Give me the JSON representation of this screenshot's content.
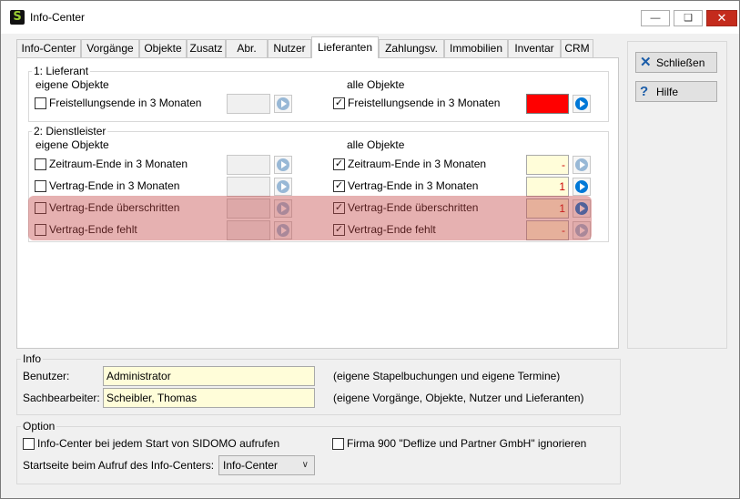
{
  "window": {
    "title": "Info-Center",
    "app_icon_letter": "S",
    "minimize": "▭",
    "restore": "▭",
    "close": "✕"
  },
  "tabs": [
    "Info-Center",
    "Vorgänge",
    "Objekte",
    "Zusatz",
    "Abr.",
    "Nutzer",
    "Lieferanten",
    "Zahlungsv.",
    "Immobilien",
    "Inventar",
    "CRM"
  ],
  "active_tab": "Lieferanten",
  "lieferant": {
    "title": "1: Lieferant",
    "own_header": "eigene Objekte",
    "all_header": "alle Objekte",
    "own_row": {
      "label": "Freistellungsende in 3 Monaten",
      "checked": false,
      "value": ""
    },
    "all_row": {
      "label": "Freistellungsende in 3 Monaten",
      "checked": true,
      "value": "",
      "color": "#ff0000"
    }
  },
  "dienstleister": {
    "title": "2: Dienstleister",
    "own_header": "eigene Objekte",
    "all_header": "alle Objekte",
    "own_rows": [
      {
        "label": "Zeitraum-Ende in 3 Monaten",
        "checked": false,
        "value": ""
      },
      {
        "label": "Vertrag-Ende in 3 Monaten",
        "checked": false,
        "value": ""
      },
      {
        "label": "Vertrag-Ende überschritten",
        "checked": false,
        "value": ""
      },
      {
        "label": "Vertrag-Ende fehlt",
        "checked": false,
        "value": ""
      }
    ],
    "all_rows": [
      {
        "label": "Zeitraum-Ende in 3 Monaten",
        "checked": true,
        "value": "-"
      },
      {
        "label": "Vertrag-Ende in 3 Monaten",
        "checked": true,
        "value": "1"
      },
      {
        "label": "Vertrag-Ende überschritten",
        "checked": true,
        "value": "1"
      },
      {
        "label": "Vertrag-Ende fehlt",
        "checked": true,
        "value": "-"
      }
    ]
  },
  "buttons": {
    "close": "Schließen",
    "help": "Hilfe",
    "close_icon": "x-icon",
    "help_icon": "question-icon"
  },
  "info": {
    "title": "Info",
    "benutzer_label": "Benutzer:",
    "benutzer_value": "Administrator",
    "benutzer_note": "(eigene Stapelbuchungen und eigene Termine)",
    "sach_label": "Sachbearbeiter:",
    "sach_value": "Scheibler, Thomas",
    "sach_note": "(eigene Vorgänge, Objekte, Nutzer und Lieferanten)"
  },
  "option": {
    "title": "Option",
    "startup_label": "Info-Center bei jedem Start von SIDOMO aufrufen",
    "startup_checked": false,
    "firma_label": "Firma 900 \"Deflize und Partner GmbH\" ignorieren",
    "firma_checked": false,
    "startpage_label": "Startseite beim Aufruf des Info-Centers:",
    "startpage_value": "Info-Center"
  },
  "colors": {
    "highlight": "#c44646",
    "accent": "#0078d7",
    "field_bg": "#fffdd9"
  }
}
